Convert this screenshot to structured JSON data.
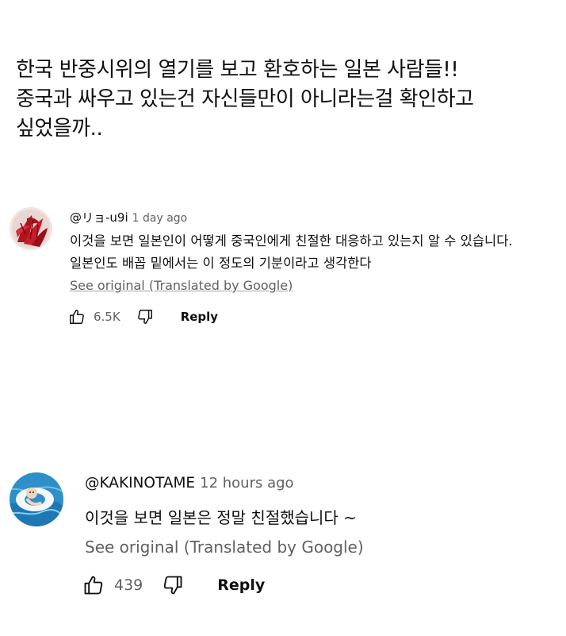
{
  "headline": {
    "lines": [
      "한국 반중시위의 열기를 보고 환호하는 일본 사람들!!",
      "중국과 싸우고 있는건 자신들만이 아니라는걸 확인하고",
      "싶었을까.."
    ]
  },
  "comments": [
    {
      "author": "@リョ-u9i",
      "time": "1 day ago",
      "lines": [
        "이것을 보면 일본인이 어떻게 중국인에게 친절한 대응하고 있는지 알 수 있습니다.",
        "일본인도 배꼽 밑에서는 이 정도의 기분이라고 생각한다"
      ],
      "see_original": "See original (Translated by Google)",
      "likes": "6.5K",
      "reply_label": "Reply"
    },
    {
      "author": "@KAKINOTAME",
      "time": "12 hours ago",
      "lines": [
        "이것을 보면 일본은 정말 친절했습니다 ~"
      ],
      "see_original": "See original (Translated by Google)",
      "likes": "439",
      "reply_label": "Reply"
    }
  ],
  "icons": {
    "like": "thumbs-up-icon",
    "dislike": "thumbs-down-icon"
  },
  "colors": {
    "primary_text": "#0f0f0f",
    "secondary_text": "#606060"
  }
}
